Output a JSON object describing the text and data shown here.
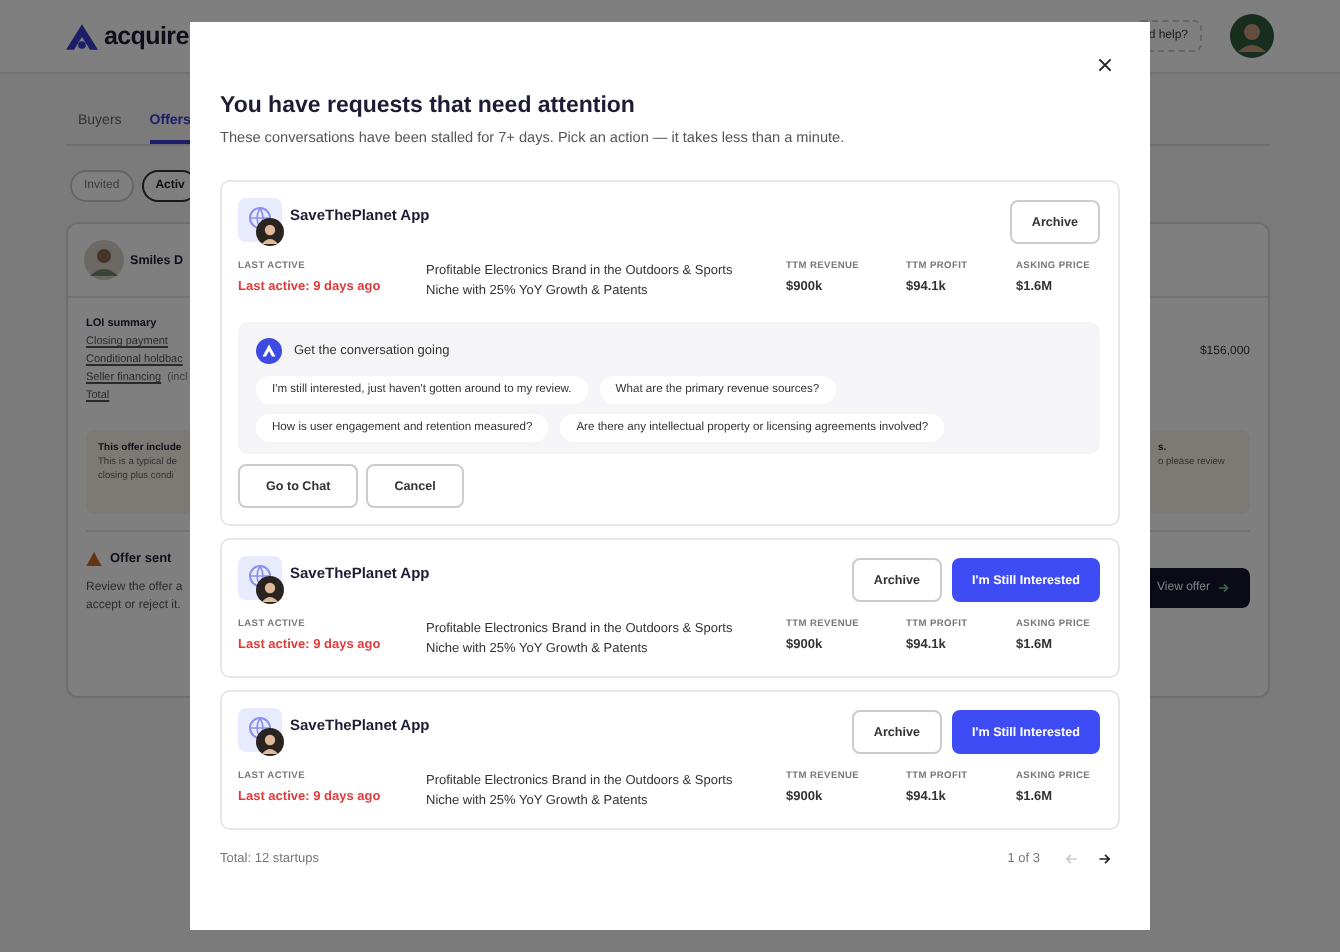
{
  "background": {
    "logo": "acquire",
    "help_button": "d help?",
    "tabs": [
      {
        "label": "Buyers",
        "selected": false
      },
      {
        "label": "Offers",
        "selected": true
      }
    ],
    "filters": [
      {
        "label": "Invited",
        "selected": false
      },
      {
        "label": "Activ",
        "selected": true
      }
    ],
    "card": {
      "name": "Smiles D",
      "loi_title": "LOI summary",
      "loi_items": [
        {
          "label": "Closing payment"
        },
        {
          "label": "Conditional holdbac"
        },
        {
          "label": "Seller financing",
          "note": "(incl"
        }
      ],
      "total_label": "Total",
      "amount": "$156,000",
      "notice": {
        "title": "This offer include",
        "lines": [
          "This is a typical de",
          "closing plus condi"
        ],
        "right_lines": [
          "s.",
          "o please review"
        ]
      },
      "status": {
        "title": "Offer sent",
        "lines": [
          "Review the offer a",
          "accept or reject it."
        ]
      },
      "view_button": "View offer"
    }
  },
  "modal": {
    "title": "You have requests that need attention",
    "subtitle": "These conversations have been stalled for 7+ days. Pick an action — it takes less than a minute.",
    "requests": [
      {
        "name": "SaveThePlanet App",
        "last_active_label": "LAST ACTIVE",
        "last_active": "Last active: 9 days ago",
        "description": "Profitable Electronics Brand in the Outdoors & Sports Niche with 25% YoY Growth & Patents",
        "metrics": [
          {
            "label": "TTM REVENUE",
            "value": "$900k"
          },
          {
            "label": "TTM PROFIT",
            "value": "$94.1k"
          },
          {
            "label": "ASKING PRICE",
            "value": "$1.6M"
          }
        ],
        "actions": [
          {
            "label": "Archive",
            "kind": "secondary"
          }
        ],
        "suggestions": {
          "title": "Get the conversation going",
          "chips": [
            "I'm still interested, just haven't gotten around to my review.",
            "What are the primary revenue sources?",
            "How is user engagement and retention measured?",
            "Are there any intellectual property or licensing agreements involved?"
          ]
        },
        "buttons": [
          "Go to Chat",
          "Cancel"
        ]
      },
      {
        "name": "SaveThePlanet App",
        "last_active_label": "LAST ACTIVE",
        "last_active": "Last active: 9 days ago",
        "description": "Profitable Electronics Brand in the Outdoors & Sports Niche with 25% YoY Growth & Patents",
        "metrics": [
          {
            "label": "TTM REVENUE",
            "value": "$900k"
          },
          {
            "label": "TTM PROFIT",
            "value": "$94.1k"
          },
          {
            "label": "ASKING PRICE",
            "value": "$1.6M"
          }
        ],
        "actions": [
          {
            "label": "Archive",
            "kind": "secondary"
          },
          {
            "label": "I'm Still Interested",
            "kind": "primary"
          }
        ]
      },
      {
        "name": "SaveThePlanet App",
        "last_active_label": "LAST ACTIVE",
        "last_active": "Last active: 9 days ago",
        "description": "Profitable Electronics Brand in the Outdoors & Sports Niche with 25% YoY Growth & Patents",
        "metrics": [
          {
            "label": "TTM REVENUE",
            "value": "$900k"
          },
          {
            "label": "TTM PROFIT",
            "value": "$94.1k"
          },
          {
            "label": "ASKING PRICE",
            "value": "$1.6M"
          }
        ],
        "actions": [
          {
            "label": "Archive",
            "kind": "secondary"
          },
          {
            "label": "I'm Still Interested",
            "kind": "primary"
          }
        ]
      }
    ],
    "footer": {
      "total": "Total: 12 startups",
      "page": "1 of 3",
      "pager": [
        {
          "kind": "prev",
          "disabled": true
        },
        {
          "kind": "next",
          "disabled": false
        }
      ]
    }
  }
}
